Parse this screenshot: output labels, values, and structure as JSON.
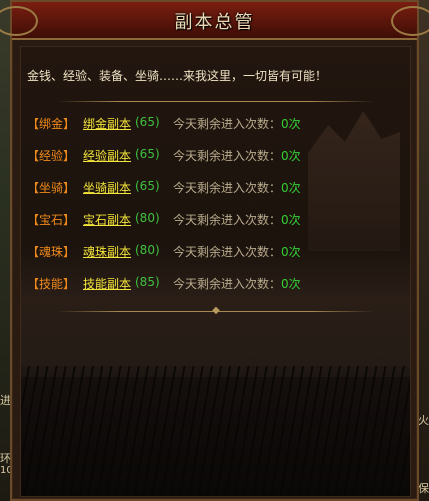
{
  "window": {
    "title": "副本总管"
  },
  "intro_text": "金钱、经验、装备、坐骑……来我这里，一切皆有可能！",
  "dungeons": [
    {
      "category": "【绑金】",
      "name": "绑金副本",
      "level": "(65)",
      "remain_label": "今天剩余进入次数：",
      "count": "0次"
    },
    {
      "category": "【经验】",
      "name": "经验副本",
      "level": "(65)",
      "remain_label": "今天剩余进入次数：",
      "count": "0次"
    },
    {
      "category": "【坐骑】",
      "name": "坐骑副本",
      "level": "(65)",
      "remain_label": "今天剩余进入次数：",
      "count": "0次"
    },
    {
      "category": "【宝石】",
      "name": "宝石副本",
      "level": "(80)",
      "remain_label": "今天剩余进入次数：",
      "count": "0次"
    },
    {
      "category": "【魂珠】",
      "name": "魂珠副本",
      "level": "(80)",
      "remain_label": "今天剩余进入次数：",
      "count": "0次"
    },
    {
      "category": "【技能】",
      "name": "技能副本",
      "level": "(85)",
      "remain_label": "今天剩余进入次数：",
      "count": "0次"
    }
  ],
  "edge_text": {
    "left_a": "进",
    "left_b": "环",
    "left_c": "10",
    "right_a": "火",
    "right_b": "保"
  },
  "colors": {
    "category": "#f08a1a",
    "dungeon_link": "#f4e53a",
    "level": "#3fc13f",
    "count": "#35d035",
    "title_bar": "#6a1a0c"
  }
}
